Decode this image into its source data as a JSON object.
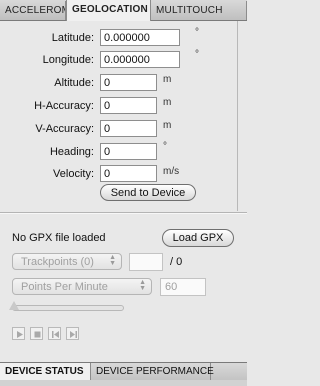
{
  "tabs": {
    "accelerometer": "ACCELEROMETER",
    "geolocation": "GEOLOCATION",
    "multitouch": "MULTITOUCH"
  },
  "fields": {
    "latitude": {
      "label": "Latitude:",
      "value": "0.000000",
      "unit": "°"
    },
    "longitude": {
      "label": "Longitude:",
      "value": "0.000000",
      "unit": "°"
    },
    "altitude": {
      "label": "Altitude:",
      "value": "0",
      "unit": "m"
    },
    "h_accuracy": {
      "label": "H-Accuracy:",
      "value": "0",
      "unit": "m"
    },
    "v_accuracy": {
      "label": "V-Accuracy:",
      "value": "0",
      "unit": "m"
    },
    "heading": {
      "label": "Heading:",
      "value": "0",
      "unit": "°"
    },
    "velocity": {
      "label": "Velocity:",
      "value": "0",
      "unit": "m/s"
    }
  },
  "send_button": "Send to Device",
  "gpx": {
    "status": "No GPX file loaded",
    "load_button": "Load GPX",
    "trackpoints_select": "Trackpoints (0)",
    "trackpoint_total": "/ 0",
    "speed_unit_select": "Points Per Minute",
    "speed_value": "60"
  },
  "bottom_tabs": {
    "device_status": "DEVICE STATUS",
    "device_performance": "DEVICE PERFORMANCE"
  }
}
